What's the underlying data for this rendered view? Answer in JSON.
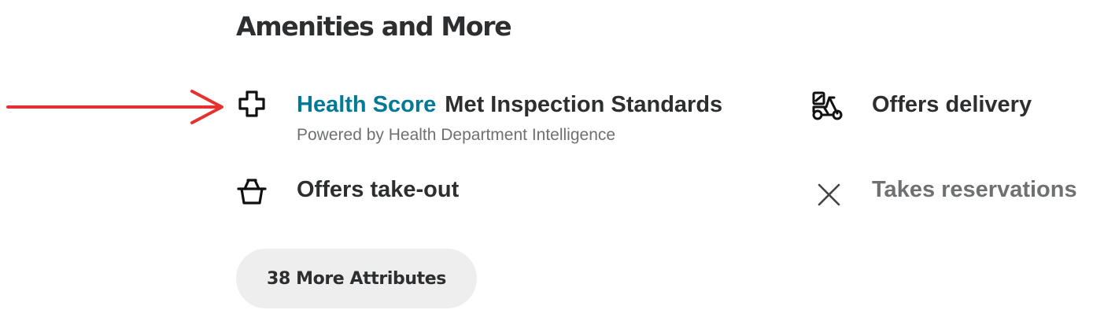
{
  "section": {
    "title": "Amenities and More"
  },
  "amenities": {
    "health": {
      "icon": "medical-cross-icon",
      "link_label": "Health Score",
      "status": "Met Inspection Standards",
      "subtext": "Powered by Health Department Intelligence"
    },
    "delivery": {
      "icon": "scooter-icon",
      "label": "Offers delivery"
    },
    "takeout": {
      "icon": "basket-icon",
      "label": "Offers take-out"
    },
    "reservations": {
      "icon": "close-x-icon",
      "label": "Takes reservations",
      "available": false
    }
  },
  "more_button": {
    "label": "38 More Attributes"
  },
  "annotation": {
    "icon": "arrow-icon",
    "color": "#e8312f"
  },
  "colors": {
    "link": "#027a97",
    "text": "#2d2e2f",
    "muted": "#6e7072",
    "button_bg": "#eeeeef"
  }
}
